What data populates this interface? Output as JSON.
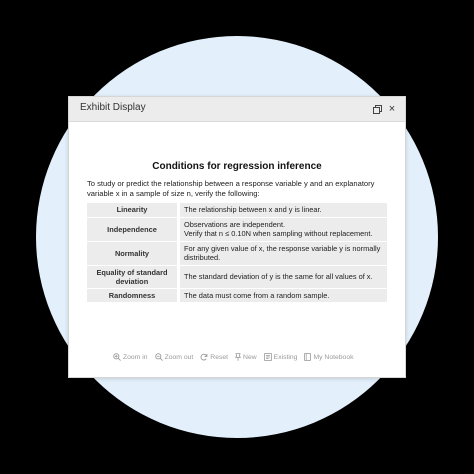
{
  "dialog": {
    "title": "Exhibit Display",
    "restore_icon": "restore-window-icon",
    "close_label": "×"
  },
  "content": {
    "heading": "Conditions for regression inference",
    "intro": "To study or predict the relationship between a response variable y and an explanatory variable x in a sample of size n, verify the following:",
    "rows": [
      {
        "label": "Linearity",
        "lines": [
          "The relationship between x and y is linear."
        ]
      },
      {
        "label": "Independence",
        "lines": [
          "Observations are independent.",
          "Verify that n ≤ 0.10N when sampling without replacement."
        ]
      },
      {
        "label": "Normality",
        "lines": [
          "For any given value of x, the response variable y is normally distributed."
        ]
      },
      {
        "label": "Equality of standard deviation",
        "lines": [
          "The standard deviation of y is the same for all values of x."
        ]
      },
      {
        "label": "Randomness",
        "lines": [
          "The data must come from a random sample."
        ]
      }
    ]
  },
  "toolbar": {
    "zoom_in": "Zoom in",
    "zoom_out": "Zoom out",
    "reset": "Reset",
    "new": "New",
    "existing": "Existing",
    "notebook": "My Notebook"
  },
  "colors": {
    "page_background": "#000000",
    "backdrop_circle": "#e3f0fb",
    "titlebar": "#ececec",
    "table_cell": "#ececec",
    "toolbar_text": "#9a9a9a"
  }
}
